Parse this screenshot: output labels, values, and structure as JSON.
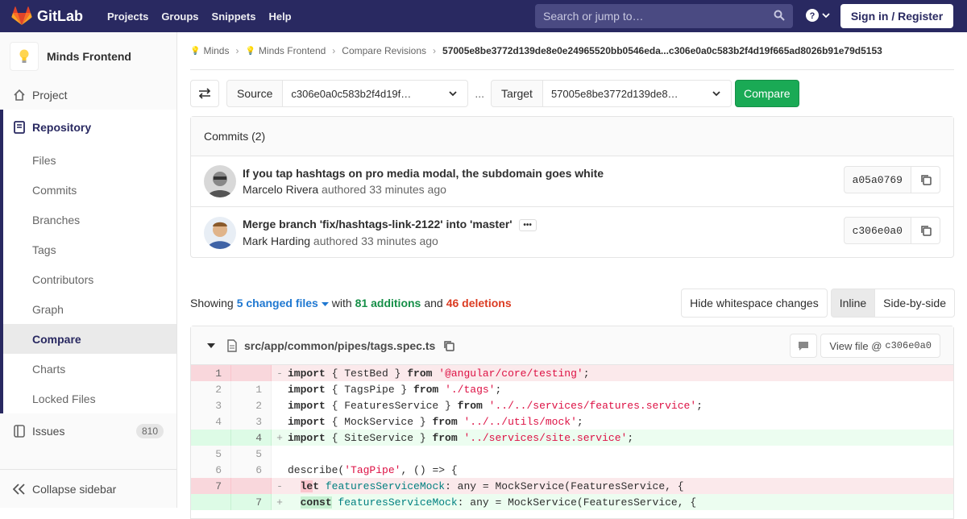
{
  "nav": {
    "brand": "GitLab",
    "links": [
      "Projects",
      "Groups",
      "Snippets",
      "Help"
    ],
    "search_placeholder": "Search or jump to…",
    "signin": "Sign in / Register"
  },
  "sidebar": {
    "project_name": "Minds Frontend",
    "project": "Project",
    "repository": "Repository",
    "repo_items": [
      "Files",
      "Commits",
      "Branches",
      "Tags",
      "Contributors",
      "Graph",
      "Compare",
      "Charts",
      "Locked Files"
    ],
    "active_item": "Compare",
    "issues": "Issues",
    "issues_count": "810",
    "collapse": "Collapse sidebar"
  },
  "breadcrumb": {
    "group": "Minds",
    "project": "Minds Frontend",
    "section": "Compare Revisions",
    "current": "57005e8be3772d139de8e0e24965520bb0546eda...c306e0a0c583b2f4d19f665ad8026b91e79d5153"
  },
  "compare": {
    "source_label": "Source",
    "source_value": "c306e0a0c583b2f4d19f…",
    "separator": "...",
    "target_label": "Target",
    "target_value": "57005e8be3772d139de8…",
    "button": "Compare"
  },
  "commits": {
    "header": "Commits (2)",
    "items": [
      {
        "title": "If you tap hashtags on pro media modal, the subdomain goes white",
        "author": "Marcelo Rivera",
        "meta": "authored 33 minutes ago",
        "sha": "a05a0769"
      },
      {
        "title": "Merge branch 'fix/hashtags-link-2122' into 'master'",
        "author": "Mark Harding",
        "meta": "authored 33 minutes ago",
        "sha": "c306e0a0"
      }
    ]
  },
  "stats": {
    "showing": "Showing",
    "changed_files": "5 changed files",
    "with": "with",
    "additions": "81 additions",
    "and": "and",
    "deletions": "46 deletions",
    "hide_ws": "Hide whitespace changes",
    "inline": "Inline",
    "side_by_side": "Side-by-side"
  },
  "file": {
    "path": "src/app/common/pipes/tags.spec.ts",
    "view_file": "View file @",
    "view_sha": "c306e0a0",
    "lines": [
      {
        "type": "del",
        "old": "1",
        "new": "",
        "mark": "-"
      },
      {
        "type": "ctx",
        "old": "2",
        "new": "1",
        "mark": ""
      },
      {
        "type": "ctx",
        "old": "3",
        "new": "2",
        "mark": ""
      },
      {
        "type": "ctx",
        "old": "4",
        "new": "3",
        "mark": ""
      },
      {
        "type": "add",
        "old": "",
        "new": "4",
        "mark": "+"
      },
      {
        "type": "ctx",
        "old": "5",
        "new": "5",
        "mark": ""
      },
      {
        "type": "ctx",
        "old": "6",
        "new": "6",
        "mark": ""
      },
      {
        "type": "del",
        "old": "7",
        "new": "",
        "mark": "-"
      },
      {
        "type": "add",
        "old": "",
        "new": "7",
        "mark": "+"
      }
    ],
    "code": {
      "l1": [
        "import",
        " { TestBed } ",
        "from",
        " ",
        "'@angular/core/testing'",
        ";"
      ],
      "l2": [
        "import",
        " { TagsPipe } ",
        "from",
        " ",
        "'./tags'",
        ";"
      ],
      "l3": [
        "import",
        " { FeaturesService } ",
        "from",
        " ",
        "'../../services/features.service'",
        ";"
      ],
      "l4": [
        "import",
        " { MockService } ",
        "from",
        " ",
        "'../../utils/mock'",
        ";"
      ],
      "l5": [
        "import",
        " { SiteService } ",
        "from",
        " ",
        "'../services/site.service'",
        ";"
      ],
      "l6": "",
      "l7": [
        "describe(",
        "'TagPipe'",
        ", () => {"
      ],
      "l8": [
        "  ",
        "le",
        "t",
        " ",
        "featuresServiceMock",
        ": any = MockService(FeaturesService, {"
      ],
      "l9": [
        "  ",
        "const",
        " ",
        "featuresServiceMock",
        ": any = MockService(FeaturesService, {"
      ]
    }
  }
}
